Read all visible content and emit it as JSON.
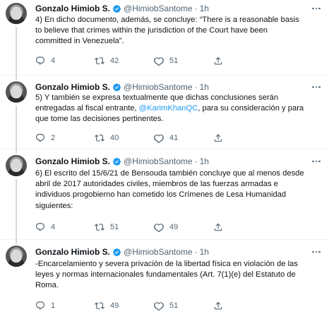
{
  "author": {
    "name": "Gonzalo Himiob S.",
    "handle": "@HimiobSantome",
    "separator": "·",
    "time": "1h"
  },
  "colors": {
    "accent": "#1d9bf0",
    "secondary_text": "#536471"
  },
  "tweets": [
    {
      "text": "4) En dicho documento, además, se concluye: “There is a reasonable basis\nto believe that crimes within the jurisdiction of the Court have been\ncommitted in Venezuela”.",
      "replies": "4",
      "retweets": "42",
      "likes": "51"
    },
    {
      "text_before": "5) Y también se expresa textualmente que dichas conclusiones serán\nentregadas al fiscal entrante, ",
      "mention": "@KarimKhanQC",
      "text_after": ", para su consideración y para\nque tome las decisiones pertinentes.",
      "replies": "2",
      "retweets": "40",
      "likes": "41"
    },
    {
      "text": "6) El escrito del 15/6/21 de Bensouda también concluye que al menos desde\nabril de 2017 autoridades civiles, miembros de las fuerzas armadas e\nindividuos progobierno han cometido los Crímenes de Lesa Humanidad\nsiguientes:",
      "replies": "4",
      "retweets": "51",
      "likes": "49"
    },
    {
      "text": "-Encarcelamiento y severa privación de la libertad física en violación de las\nleyes y normas internacionales fundamentales (Art. 7(1)(e) del Estatuto de\nRoma.",
      "replies": "1",
      "retweets": "49",
      "likes": "51"
    }
  ]
}
